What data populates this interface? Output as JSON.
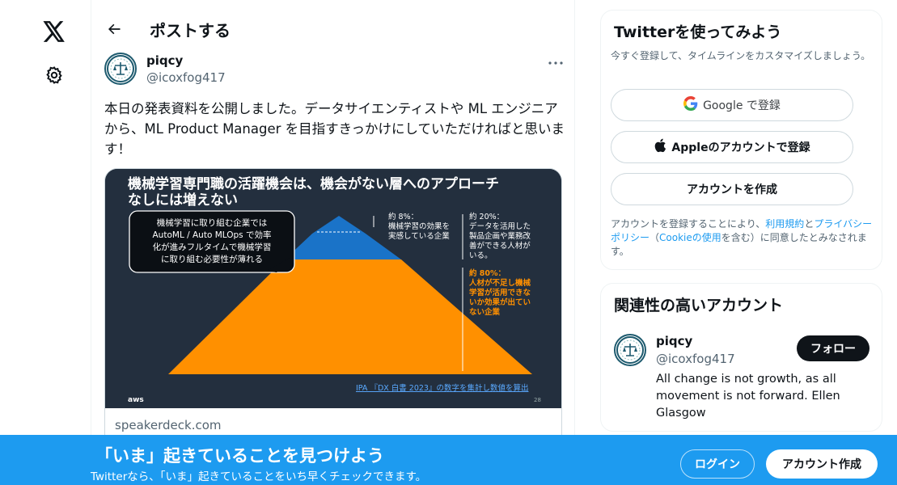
{
  "sidebar": {
    "logo_icon": "x-logo-icon",
    "settings_icon": "gear-icon"
  },
  "header": {
    "back_icon": "arrow-left-icon",
    "title": "ポストする"
  },
  "post": {
    "author_name": "piqcy",
    "author_handle": "@icoxfog417",
    "more_icon": "more-dots-icon",
    "text": "本日の発表資料を公開しました。データサイエンティストや ML エンジニアから、ML Product Manager を目指すきっかけにしていただければと思います！",
    "card": {
      "slide": {
        "title_line1": "機械学習専門職の活躍機会は、機会がない層へのアプローチ",
        "title_line2": "なしには増えない",
        "callout_lines": [
          "機械学習に取り組む企業では",
          "AutoML / Auto MLOps で効率",
          "化が進みフルタイムで機械学習",
          "に取り組む必要性が薄れる"
        ],
        "label_top_lines": [
          "約 8%：",
          "機械学習の効果を",
          "実感している企業"
        ],
        "label_mid_lines": [
          "約 20%：",
          "データを活用した",
          "製品企画や業務改",
          "善ができる人材が",
          "いる。"
        ],
        "label_bottom_lines": [
          "約 80%：",
          "人材が不足し機械",
          "学習が活用できな",
          "いか効果が出てい",
          "ない企業"
        ],
        "source": "IPA 『DX 白書 2023』の数字を集計し数値を算出",
        "footer_brand": "aws",
        "page_number": "28",
        "colors": {
          "background": "#232f3e",
          "orange": "#ff9000",
          "blue": "#1a73c8",
          "accent_text": "#ff9000"
        }
      },
      "domain": "speakerdeck.com"
    }
  },
  "signup_box": {
    "title": "Twitterを使ってみよう",
    "subtitle": "今すぐ登録して、タイムラインをカスタマイズしましょう。",
    "google_label": "Google で登録",
    "apple_label": "Appleのアカウントで登録",
    "create_label": "アカウントを作成",
    "terms_prefix": "アカウントを登録することにより、",
    "terms_link1": "利用規約",
    "terms_and": "と",
    "terms_link2": "プライバシーポリシー",
    "terms_paren_open": "（",
    "terms_link3": "Cookieの使用",
    "terms_suffix": "を含む）に同意したとみなされます。"
  },
  "related_box": {
    "title": "関連性の高いアカウント",
    "name": "piqcy",
    "handle": "@icoxfog417",
    "bio": "All change is not growth, as all movement is not forward. Ellen Glasgow",
    "follow_label": "フォロー"
  },
  "bottom_bar": {
    "heading": "「いま」起きていることを見つけよう",
    "subtext": "Twitterなら、「いま」起きていることをいち早くチェックできます。",
    "login_label": "ログイン",
    "signup_label": "アカウント作成",
    "color": "#1d9bf0"
  }
}
